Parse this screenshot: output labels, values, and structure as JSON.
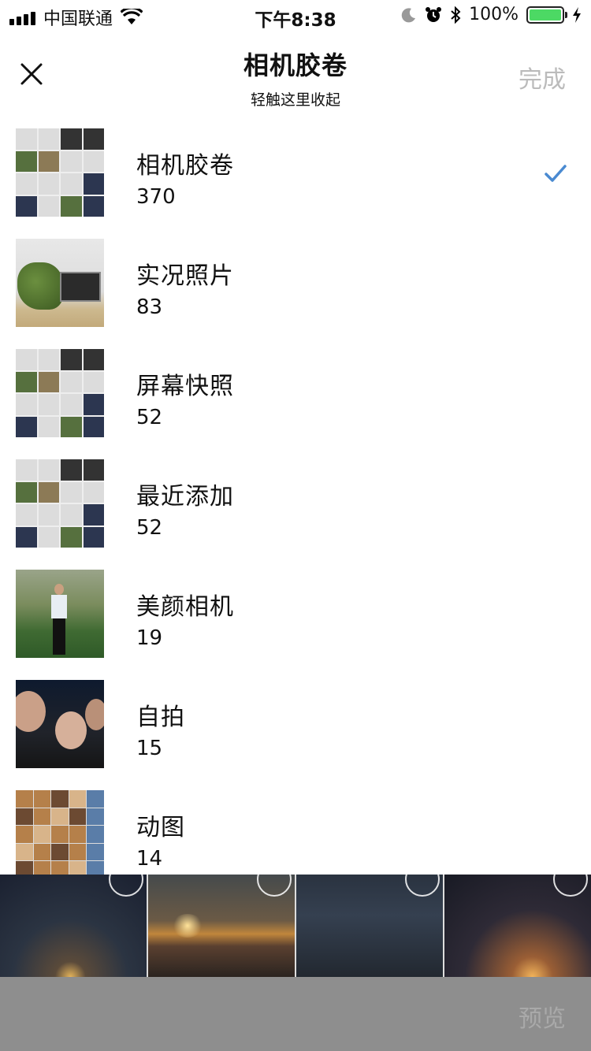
{
  "status_bar": {
    "carrier": "中国联通",
    "time": "下午8:38",
    "battery": "100%"
  },
  "nav": {
    "title": "相机胶卷",
    "subtitle": "轻触这里收起",
    "done_label": "完成",
    "done_color": "#bbbbbb"
  },
  "albums": [
    {
      "name": "相机胶卷",
      "count": "370",
      "selected": true
    },
    {
      "name": "实况照片",
      "count": "83"
    },
    {
      "name": "屏幕快照",
      "count": "52"
    },
    {
      "name": "最近添加",
      "count": "52"
    },
    {
      "name": "美颜相机",
      "count": "19"
    },
    {
      "name": "自拍",
      "count": "15"
    },
    {
      "name": "动图",
      "count": "14"
    }
  ],
  "accent_color": "#4a8ad1",
  "bottom_bar": {
    "preview_label": "预览"
  }
}
